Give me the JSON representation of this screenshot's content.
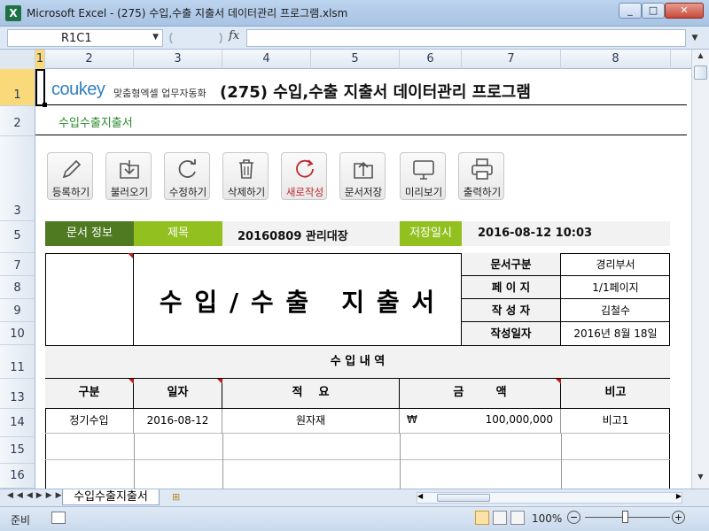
{
  "window": {
    "title": "Microsoft Excel - (275) 수입,수출 지출서 데이터관리 프로그램.xlsm",
    "minimize": "_",
    "maximize": "□",
    "close": "✕"
  },
  "formula_bar": {
    "name_box": "R1C1",
    "fx": "fx",
    "value": ""
  },
  "columns": [
    "1",
    "2",
    "3",
    "4",
    "5",
    "6",
    "7",
    "8"
  ],
  "rows": [
    "1",
    "2",
    "3",
    "5",
    "7",
    "8",
    "9",
    "10",
    "11",
    "13",
    "14",
    "15",
    "16"
  ],
  "header": {
    "logo_word": "coukey",
    "logo_tagline": "맞춤형엑셀 업무자동화",
    "app_title": "(275) 수입,수출 지출서 데이터관리 프로그램",
    "sheet_name_label": "수입수출지출서"
  },
  "toolbar": [
    {
      "label": "등록하기",
      "icon": "pencil-icon"
    },
    {
      "label": "불러오기",
      "icon": "download-folder-icon"
    },
    {
      "label": "수정하기",
      "icon": "refresh-icon"
    },
    {
      "label": "삭제하기",
      "icon": "trash-icon"
    },
    {
      "label": "새로작성",
      "icon": "new-icon"
    },
    {
      "label": "문서저장",
      "icon": "upload-folder-icon"
    },
    {
      "label": "미리보기",
      "icon": "monitor-icon"
    },
    {
      "label": "출력하기",
      "icon": "printer-icon"
    }
  ],
  "doc_info": {
    "label": "문서 정보",
    "title_label": "제목",
    "title_value": "20160809 관리대장",
    "saved_label": "저장일시",
    "saved_value": "2016-08-12 10:03"
  },
  "form": {
    "heading": "수 입 / 수 출   지 출 서",
    "meta": [
      {
        "label": "문서구분",
        "value": "경리부서"
      },
      {
        "label": "페 이 지",
        "value": "1/1페이지"
      },
      {
        "label": "작 성 자",
        "value": "김철수"
      },
      {
        "label": "작성일자",
        "value": "2016년 8월 18일"
      }
    ],
    "section_title": "수 입 내 역",
    "table_headers": [
      "구분",
      "일자",
      "적    요",
      "금        액",
      "비고"
    ],
    "table_rows": [
      {
        "type": "정기수입",
        "date": "2016-08-12",
        "desc": "원자재",
        "currency": "₩",
        "amount": "100,000,000",
        "note": "비고1"
      }
    ]
  },
  "sheet_tab": "수입수출지출서",
  "status": {
    "ready": "준비",
    "zoom": "100%"
  },
  "colors": {
    "dark_green": "#4f7a22",
    "light_green": "#92c11f",
    "logo_blue": "#2f7fc1",
    "logo_green": "#7bb32e"
  }
}
